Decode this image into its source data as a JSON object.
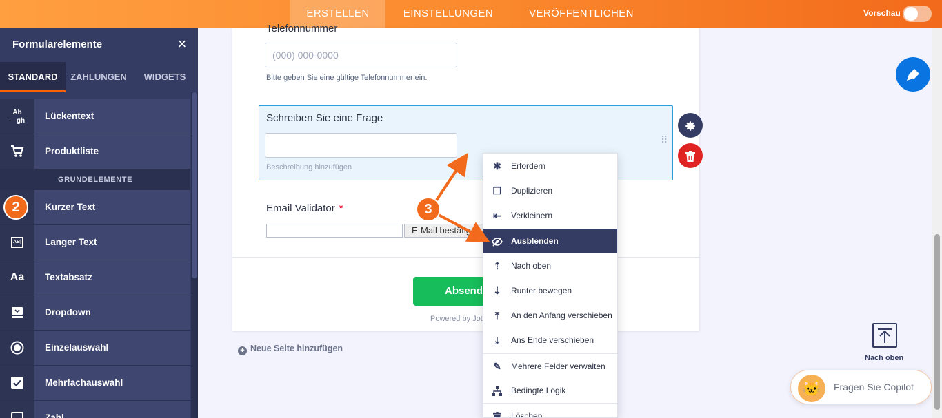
{
  "topbar": {
    "tabs": [
      "ERSTELLEN",
      "EINSTELLUNGEN",
      "VERÖFFENTLICHEN"
    ],
    "preview_label": "Vorschau"
  },
  "sidebar": {
    "title": "Formularelemente",
    "close_icon": "×",
    "tabs": [
      "STANDARD",
      "ZAHLUNGEN",
      "WIDGETS"
    ],
    "items_top": [
      {
        "icon": "fill-in-blank-icon",
        "glyph": "Ab gh",
        "label": "Lückentext"
      },
      {
        "icon": "cart-icon",
        "glyph": "🛒",
        "label": "Produktliste"
      }
    ],
    "section_label": "GRUNDELEMENTE",
    "items": [
      {
        "icon": "short-text-icon",
        "glyph": "▭",
        "label": "Kurzer Text"
      },
      {
        "icon": "long-text-icon",
        "glyph": "AB",
        "label": "Langer Text"
      },
      {
        "icon": "paragraph-icon",
        "glyph": "Aa",
        "label": "Textabsatz"
      },
      {
        "icon": "dropdown-icon",
        "glyph": "▤",
        "label": "Dropdown"
      },
      {
        "icon": "radio-icon",
        "glyph": "◉",
        "label": "Einzelauswahl"
      },
      {
        "icon": "checkbox-icon",
        "glyph": "☑",
        "label": "Mehrfachauswahl"
      },
      {
        "icon": "number-icon",
        "glyph": "▣",
        "label": "Zahl"
      }
    ]
  },
  "annotations": {
    "badge_2": "2",
    "badge_3": "3"
  },
  "form": {
    "phone_label": "Telefonnummer",
    "phone_placeholder": "(000) 000-0000",
    "phone_hint": "Bitte geben Sie eine gültige Telefonnummer ein.",
    "question_label": "Schreiben Sie eine Frage",
    "question_hint": "Beschreibung hinzufügen",
    "email_label": "Email Validator",
    "email_required": "*",
    "email_button": "E-Mail bestätigen",
    "submit_label": "Absenden",
    "powered_by": "Powered by Jotform",
    "new_page": "Neue Seite hinzufügen"
  },
  "context_menu": [
    {
      "icon": "asterisk-icon",
      "glyph": "✱",
      "label": "Erfordern"
    },
    {
      "icon": "duplicate-icon",
      "glyph": "❐",
      "label": "Duplizieren"
    },
    {
      "icon": "shrink-icon",
      "glyph": "⇤",
      "label": "Verkleinern"
    },
    {
      "icon": "eye-off-icon",
      "glyph": "◎",
      "label": "Ausblenden",
      "active": true
    },
    {
      "icon": "move-up-icon",
      "glyph": "⇡",
      "label": "Nach oben"
    },
    {
      "icon": "move-down-icon",
      "glyph": "⇣",
      "label": "Runter bewegen"
    },
    {
      "icon": "move-top-icon",
      "glyph": "⤒",
      "label": "An den Anfang verschieben"
    },
    {
      "icon": "move-bottom-icon",
      "glyph": "⤓",
      "label": "Ans Ende verschieben"
    },
    {
      "icon": "pencil-icon",
      "glyph": "✎",
      "label": "Mehrere Felder verwalten"
    },
    {
      "icon": "logic-icon",
      "glyph": "⚇",
      "label": "Bedingte Logik"
    },
    {
      "icon": "trash-icon",
      "glyph": "🗑",
      "label": "Löschen"
    }
  ],
  "right": {
    "back_to_top_label": "Nach oben",
    "copilot_label": "Fragen Sie Copilot"
  },
  "colors": {
    "accent": "#f26a1b",
    "sidebar": "#343c63",
    "submit": "#18bd5b",
    "brand_blue": "#0a74e0",
    "delete": "#e02424"
  }
}
